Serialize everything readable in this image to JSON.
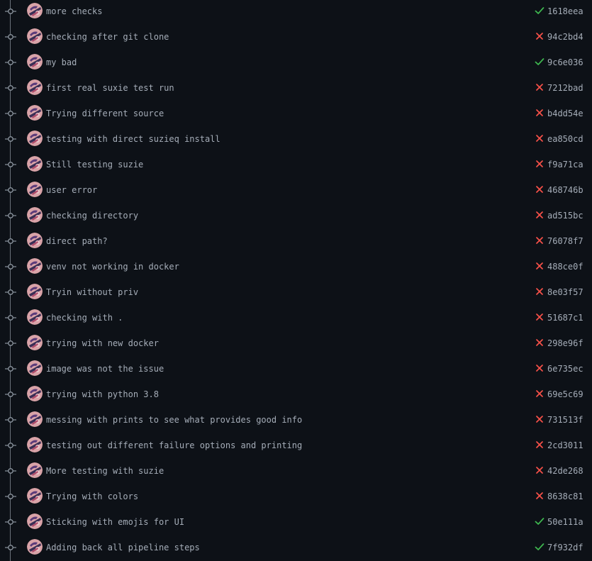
{
  "colors": {
    "background": "#0d1117",
    "text": "#a5adb8",
    "timeline": "#8b949e",
    "success": "#3fb950",
    "failure": "#f85149"
  },
  "commits": [
    {
      "message": "more checks",
      "sha": "1618eea",
      "status": "success",
      "icon": "check-icon"
    },
    {
      "message": "checking after git clone",
      "sha": "94c2bd4",
      "status": "failure",
      "icon": "x-icon"
    },
    {
      "message": "my bad",
      "sha": "9c6e036",
      "status": "success",
      "icon": "check-icon"
    },
    {
      "message": "first real suxie test run",
      "sha": "7212bad",
      "status": "failure",
      "icon": "x-icon"
    },
    {
      "message": "Trying different source",
      "sha": "b4dd54e",
      "status": "failure",
      "icon": "x-icon"
    },
    {
      "message": "testing with direct suzieq install",
      "sha": "ea850cd",
      "status": "failure",
      "icon": "x-icon"
    },
    {
      "message": "Still testing suzie",
      "sha": "f9a71ca",
      "status": "failure",
      "icon": "x-icon"
    },
    {
      "message": "user error",
      "sha": "468746b",
      "status": "failure",
      "icon": "x-icon"
    },
    {
      "message": "checking directory",
      "sha": "ad515bc",
      "status": "failure",
      "icon": "x-icon"
    },
    {
      "message": "direct path?",
      "sha": "76078f7",
      "status": "failure",
      "icon": "x-icon"
    },
    {
      "message": "venv not working in docker",
      "sha": "488ce0f",
      "status": "failure",
      "icon": "x-icon"
    },
    {
      "message": "Tryin without priv",
      "sha": "8e03f57",
      "status": "failure",
      "icon": "x-icon"
    },
    {
      "message": "checking with .",
      "sha": "51687c1",
      "status": "failure",
      "icon": "x-icon"
    },
    {
      "message": "trying with new docker",
      "sha": "298e96f",
      "status": "failure",
      "icon": "x-icon"
    },
    {
      "message": "image was not the issue",
      "sha": "6e735ec",
      "status": "failure",
      "icon": "x-icon"
    },
    {
      "message": "trying with python 3.8",
      "sha": "69e5c69",
      "status": "failure",
      "icon": "x-icon"
    },
    {
      "message": "messing with prints to see what provides good info",
      "sha": "731513f",
      "status": "failure",
      "icon": "x-icon"
    },
    {
      "message": "testing out different failure options and printing",
      "sha": "2cd3011",
      "status": "failure",
      "icon": "x-icon"
    },
    {
      "message": "More testing with suzie",
      "sha": "42de268",
      "status": "failure",
      "icon": "x-icon"
    },
    {
      "message": "Trying with colors",
      "sha": "8638c81",
      "status": "failure",
      "icon": "x-icon"
    },
    {
      "message": "Sticking with emojis for UI",
      "sha": "50e111a",
      "status": "success",
      "icon": "check-icon"
    },
    {
      "message": "Adding back all pipeline steps",
      "sha": "7f932df",
      "status": "success",
      "icon": "check-icon"
    }
  ]
}
